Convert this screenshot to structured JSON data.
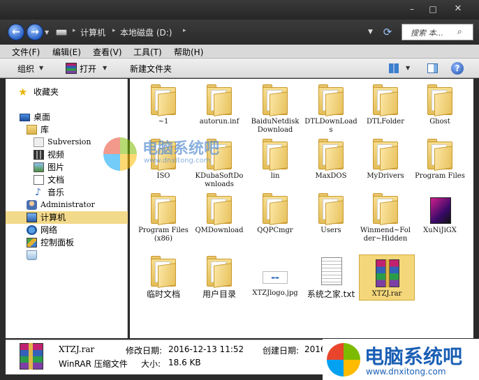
{
  "titlebar": {
    "minimize": "–",
    "maximize": "□",
    "close": "✕"
  },
  "address": {
    "breadcrumbs": [
      "计算机",
      "本地磁盘 (D:)"
    ],
    "search_placeholder": "搜索 本..."
  },
  "menu": [
    "文件(F)",
    "编辑(E)",
    "查看(V)",
    "工具(T)",
    "帮助(H)"
  ],
  "toolbar": {
    "organize": "组织",
    "open": "打开",
    "new_folder": "新建文件夹"
  },
  "nav_tree": [
    {
      "label": "收藏夹",
      "icon": "star-icon",
      "latin": false
    },
    {
      "label": "桌面",
      "icon": "desktop-icon",
      "latin": false
    },
    {
      "label": "库",
      "icon": "library-icon",
      "latin": false
    },
    {
      "label": "Subversion",
      "icon": "subversion-icon",
      "latin": true
    },
    {
      "label": "视频",
      "icon": "video-icon",
      "latin": false
    },
    {
      "label": "图片",
      "icon": "picture-icon",
      "latin": false
    },
    {
      "label": "文档",
      "icon": "document-icon",
      "latin": false
    },
    {
      "label": "音乐",
      "icon": "music-icon",
      "latin": false
    },
    {
      "label": "Administrator",
      "icon": "user-icon",
      "latin": true
    },
    {
      "label": "计算机",
      "icon": "computer-icon",
      "latin": false
    },
    {
      "label": "网络",
      "icon": "network-icon",
      "latin": false
    },
    {
      "label": "控制面板",
      "icon": "control-panel-icon",
      "latin": false
    },
    {
      "label": "",
      "icon": "recycle-bin-icon",
      "latin": false
    }
  ],
  "files": [
    {
      "name": "~1",
      "type": "folder"
    },
    {
      "name": "autorun.inf",
      "type": "folder"
    },
    {
      "name": "BaiduNetdiskDownload",
      "type": "folder"
    },
    {
      "name": "DTLDownLoads",
      "type": "folder"
    },
    {
      "name": "DTLFolder",
      "type": "folder"
    },
    {
      "name": "Ghost",
      "type": "folder"
    },
    {
      "name": "ISO",
      "type": "folder"
    },
    {
      "name": "KDubaSoftDownloads",
      "type": "folder"
    },
    {
      "name": "lin",
      "type": "folder"
    },
    {
      "name": "MaxDOS",
      "type": "folder"
    },
    {
      "name": "MyDrivers",
      "type": "folder"
    },
    {
      "name": "Program Files",
      "type": "folder"
    },
    {
      "name": "Program Files (x86)",
      "type": "folder"
    },
    {
      "name": "QMDownload",
      "type": "folder"
    },
    {
      "name": "QQPCmgr",
      "type": "folder"
    },
    {
      "name": "Users",
      "type": "folder"
    },
    {
      "name": "Winmend~Folder~Hidden",
      "type": "folder"
    },
    {
      "name": "XuNiJiGX",
      "type": "app"
    },
    {
      "name": "临时文档",
      "type": "folder"
    },
    {
      "name": "用户目录",
      "type": "folder"
    },
    {
      "name": "XTZJlogo.jpg",
      "type": "jpg"
    },
    {
      "name": "系统之家.txt",
      "type": "txt"
    },
    {
      "name": "XTZJ.rar",
      "type": "rar",
      "selected": true
    }
  ],
  "details": {
    "name": "XTZJ.rar",
    "type": "WinRAR 压缩文件",
    "modified_label": "修改日期:",
    "modified_value": "2016-12-13 11:52",
    "size_label": "大小:",
    "size_value": "18.6 KB",
    "created_label": "创建日期:",
    "created_value": "2016-"
  },
  "watermark": {
    "text": "电脑系统吧",
    "url": "www.dnxitong.com"
  },
  "colors": {
    "selection": "#f4d77a",
    "logo_red": "#e8452c",
    "logo_green": "#7cbb00",
    "logo_blue": "#00a1f1",
    "logo_yellow": "#ffbb00"
  }
}
